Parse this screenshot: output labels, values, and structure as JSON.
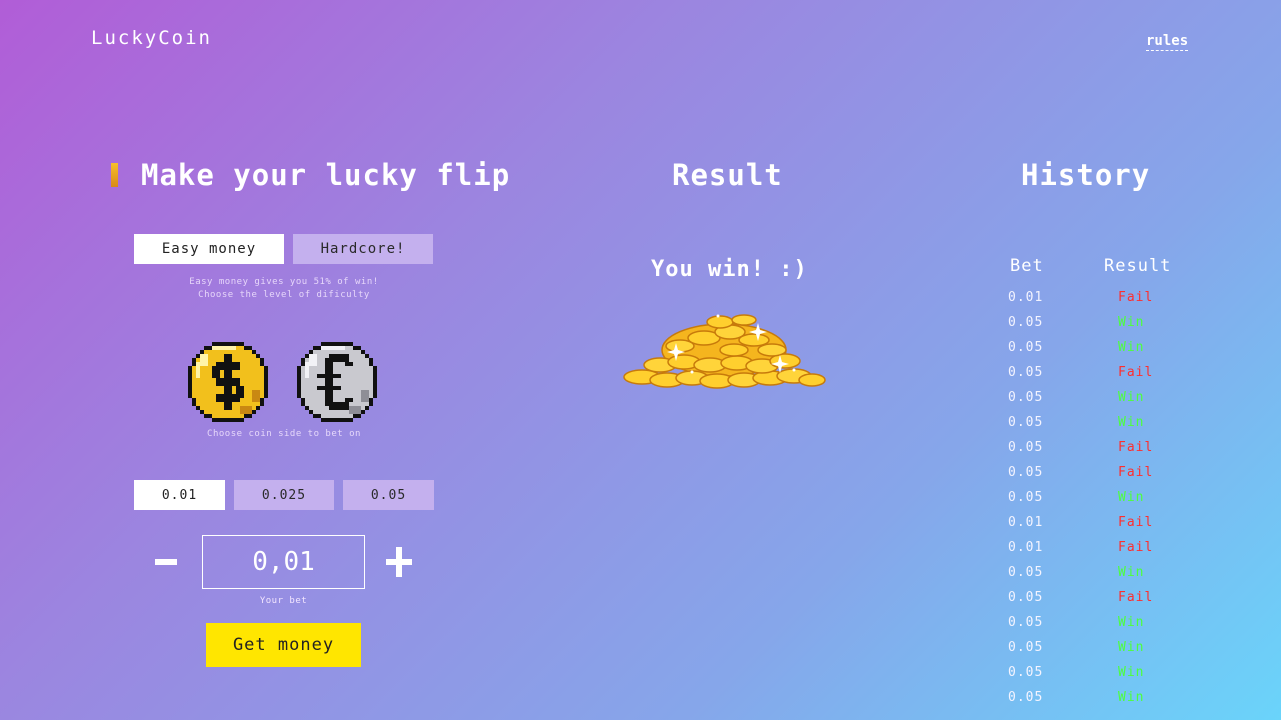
{
  "header": {
    "logo": "LuckyCoin",
    "rules_link": "rules"
  },
  "flip_panel": {
    "title": "Make your lucky flip",
    "modes": [
      {
        "label": "Easy money",
        "selected": true
      },
      {
        "label": "Hardcore!",
        "selected": false
      }
    ],
    "mode_hint_line1": "Easy money gives you 51% of win!",
    "mode_hint_line2": "Choose the level of dificulty",
    "coins": [
      {
        "icon": "dollar-coin-icon",
        "selected": false
      },
      {
        "icon": "euro-coin-icon",
        "selected": false
      }
    ],
    "coin_hint": "Choose coin side to bet on",
    "amounts": [
      {
        "label": "0.01",
        "selected": true
      },
      {
        "label": "0.025",
        "selected": false
      },
      {
        "label": "0.05",
        "selected": false
      }
    ],
    "bet_value": "0,01",
    "bet_label": "Your bet",
    "submit_label": "Get money"
  },
  "result_panel": {
    "title": "Result",
    "message": "You win! :)",
    "image_icon": "gold-coin-pile-icon"
  },
  "history_panel": {
    "title": "History",
    "col_bet": "Bet",
    "col_result": "Result",
    "rows": [
      {
        "bet": "0.01",
        "result": "Fail"
      },
      {
        "bet": "0.05",
        "result": "Win"
      },
      {
        "bet": "0.05",
        "result": "Win"
      },
      {
        "bet": "0.05",
        "result": "Fail"
      },
      {
        "bet": "0.05",
        "result": "Win"
      },
      {
        "bet": "0.05",
        "result": "Win"
      },
      {
        "bet": "0.05",
        "result": "Fail"
      },
      {
        "bet": "0.05",
        "result": "Fail"
      },
      {
        "bet": "0.05",
        "result": "Win"
      },
      {
        "bet": "0.01",
        "result": "Fail"
      },
      {
        "bet": "0.01",
        "result": "Fail"
      },
      {
        "bet": "0.05",
        "result": "Win"
      },
      {
        "bet": "0.05",
        "result": "Fail"
      },
      {
        "bet": "0.05",
        "result": "Win"
      },
      {
        "bet": "0.05",
        "result": "Win"
      },
      {
        "bet": "0.05",
        "result": "Win"
      },
      {
        "bet": "0.05",
        "result": "Win"
      }
    ]
  },
  "colors": {
    "accent_yellow": "#ffe600",
    "fail": "#ff2e2e",
    "win": "#4dff3c",
    "selected_bg": "#ffffff",
    "unselected_bg": "#c4b0ee"
  }
}
